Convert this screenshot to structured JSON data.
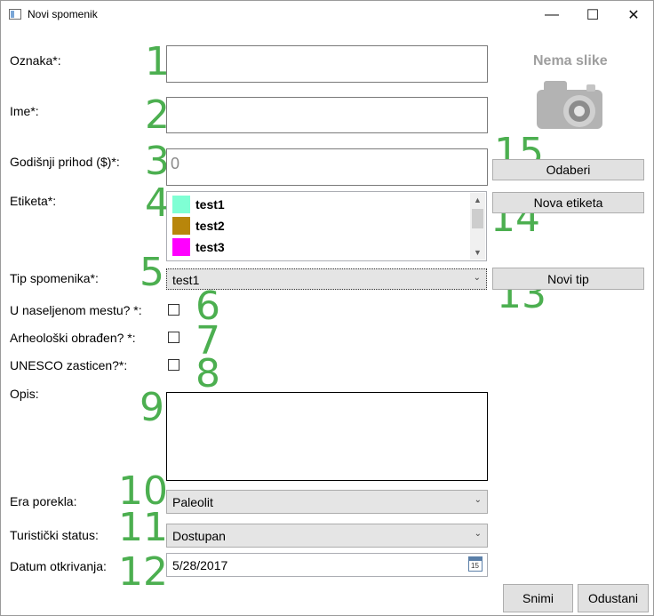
{
  "window": {
    "title": "Novi spomenik",
    "minimize": "—",
    "maximize": "☐",
    "close": "✕"
  },
  "labels": {
    "oznaka": "Oznaka*:",
    "ime": "Ime*:",
    "prihod": "Godišnji prihod ($)*:",
    "etiketa": "Etiketa*:",
    "tip": "Tip spomenika*:",
    "naseljeno": "U naseljenom mestu? *:",
    "arheoloski": "Arheološki obrađen? *:",
    "unesco": "UNESCO zasticen?*:",
    "opis": "Opis:",
    "era": "Era porekla:",
    "turisticki": "Turistički status:",
    "datum": "Datum otkrivanja:"
  },
  "numbers": [
    "1",
    "2",
    "3",
    "4",
    "5",
    "6",
    "7",
    "8",
    "9",
    "10",
    "11",
    "12",
    "13",
    "14",
    "15"
  ],
  "fields": {
    "oznaka_value": "",
    "ime_value": "",
    "prihod_value": "0",
    "opis_value": "",
    "datum_value": "5/28/2017"
  },
  "etikete": [
    {
      "label": "test1",
      "color": "#7fffd4"
    },
    {
      "label": "test2",
      "color": "#b8860b"
    },
    {
      "label": "test3",
      "color": "#ff00ff"
    }
  ],
  "tip_selected": "test1",
  "era_selected": "Paleolit",
  "status_selected": "Dostupan",
  "checkboxes": {
    "naseljeno": false,
    "arheoloski": false,
    "unesco": false
  },
  "image": {
    "placeholder": "Nema slike",
    "icon": "camera-icon"
  },
  "buttons": {
    "odaberi": "Odaberi",
    "nova_etiketa": "Nova etiketa",
    "novi_tip": "Novi tip",
    "snimi": "Snimi",
    "odustani": "Odustani"
  },
  "colors": {
    "annotation": "#4caf50"
  }
}
